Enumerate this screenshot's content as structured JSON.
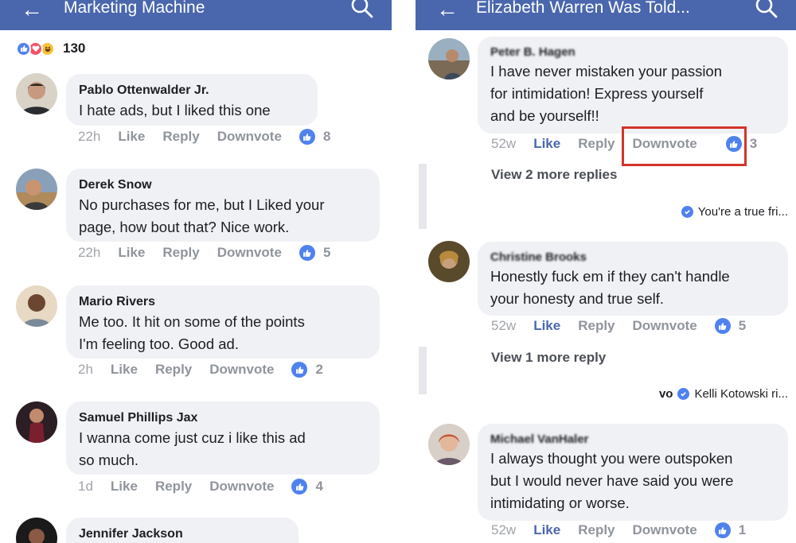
{
  "left": {
    "header": {
      "back": "←",
      "title": "Marketing Machine"
    },
    "reactions": {
      "count": "130"
    },
    "comments": [
      {
        "name": "Pablo Ottenwalder Jr.",
        "lines": [
          "I hate ads, but I liked this one"
        ],
        "time": "22h",
        "like": "Like",
        "reply": "Reply",
        "downvote": "Downvote",
        "reactions": "8"
      },
      {
        "name": "Derek Snow",
        "lines": [
          "No purchases for me, but I Liked your",
          "page, how bout that? Nice work."
        ],
        "time": "22h",
        "like": "Like",
        "reply": "Reply",
        "downvote": "Downvote",
        "reactions": "5"
      },
      {
        "name": "Mario Rivers",
        "lines": [
          "Me too. It hit on some of the points",
          "I'm feeling too. Good ad."
        ],
        "time": "2h",
        "like": "Like",
        "reply": "Reply",
        "downvote": "Downvote",
        "reactions": "2"
      },
      {
        "name": "Samuel Phillips Jax",
        "lines": [
          "I wanna come just cuz i like this ad",
          "so much."
        ],
        "time": "1d",
        "like": "Like",
        "reply": "Reply",
        "downvote": "Downvote",
        "reactions": "4"
      },
      {
        "name": "Jennifer Jackson"
      }
    ]
  },
  "right": {
    "header": {
      "back": "←",
      "title": "Elizabeth Warren Was Told..."
    },
    "comments": [
      {
        "name": "Peter B. Hagen",
        "lines": [
          "I have never mistaken your passion",
          "for intimidation! Express yourself",
          "and be yourself!!"
        ],
        "time": "52w",
        "like": "Like",
        "reply": "Reply",
        "downvote": "Downvote",
        "reactions": "3"
      },
      {
        "name": "Christine Brooks",
        "lines": [
          "Honestly fuck em if they can't handle",
          "your honesty and true self."
        ],
        "time": "52w",
        "like": "Like",
        "reply": "Reply",
        "downvote": "Downvote",
        "reactions": "5"
      },
      {
        "name": "Michael VanHaler",
        "lines": [
          "I always thought you were outspoken",
          "but I would never have said you were",
          "intimidating or worse."
        ],
        "time": "52w",
        "like": "Like",
        "reply": "Reply",
        "downvote": "Downvote",
        "reactions": "1"
      }
    ],
    "more_replies": [
      "View 2 more replies",
      "View 1 more reply"
    ],
    "reply_refs": [
      "You're a true fri...",
      "Kelli Kotowski ri..."
    ],
    "reply_ref_prefix": "vo"
  },
  "colors": {
    "header": "#4a67ad",
    "bubble": "#f0f1f4",
    "like_blue": "#4f82ee",
    "highlight": "#d4342a"
  }
}
